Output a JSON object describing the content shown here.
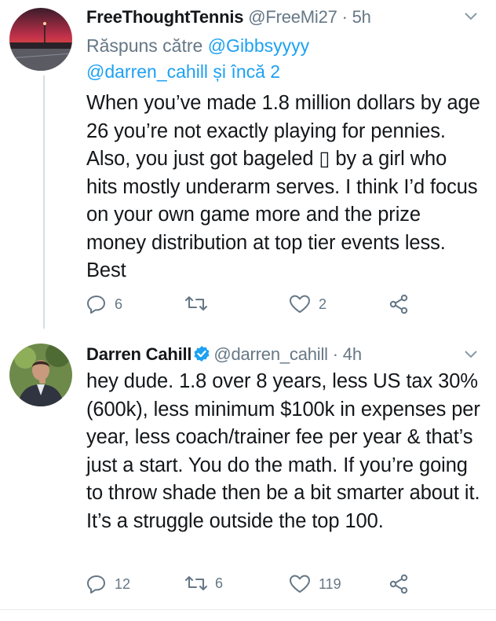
{
  "tweets": [
    {
      "display_name": "FreeThoughtTennis",
      "handle": "@FreeMi27",
      "time": "· 5h",
      "reply_prefix": "Răspuns către ",
      "reply_user": "@Gibbsyyyy",
      "reply_user2": "@darren_cahill",
      "reply_suffix": " și încă 2",
      "text": "When you’ve made 1.8 million dollars by age 26 you’re not exactly playing for pennies.  Also, you just got bageled ▯ by a girl who hits mostly underarm serves.  I think I’d focus on your own game more and the prize money distribution at top tier events less.  Best",
      "reply_count": "6",
      "retweet_count": "",
      "like_count": "2"
    },
    {
      "display_name": "Darren Cahill",
      "handle": "@darren_cahill",
      "time": "· 4h",
      "text": "hey dude. 1.8 over 8 years, less US tax 30% (600k), less minimum $100k in expenses per year, less coach/trainer fee per year & that’s just a start. You do the math. If you’re going to throw shade then be a bit smarter about it. It’s a struggle outside the top 100.",
      "reply_count": "12",
      "retweet_count": "6",
      "like_count": "119"
    }
  ],
  "icons": {
    "reply": "reply-icon",
    "retweet": "retweet-icon",
    "like": "heart-icon",
    "share": "share-icon",
    "more": "chevron-down-icon",
    "verified": "verified-badge-icon"
  },
  "colors": {
    "text": "#14171a",
    "muted": "#657786",
    "link": "#1da1f2",
    "divider": "#e6ecf0"
  }
}
